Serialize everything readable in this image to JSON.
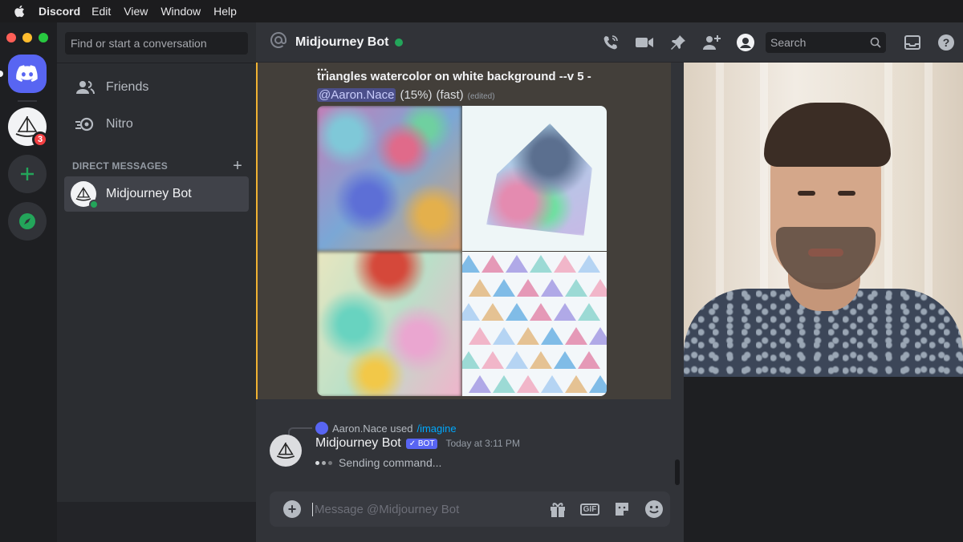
{
  "menubar": {
    "app_name": "Discord",
    "items": [
      "Edit",
      "View",
      "Window",
      "Help"
    ]
  },
  "colors": {
    "blurple": "#5865f2",
    "online": "#23a55a",
    "highlight_border": "#f0b232",
    "mention_badge": "#f23f42"
  },
  "servers": {
    "home_icon": "discord-logo-icon",
    "midjourney_badge": "3",
    "add_icon": "plus-icon",
    "explore_icon": "compass-icon"
  },
  "sidebar": {
    "search_placeholder": "Find or start a conversation",
    "nav": [
      {
        "label": "Friends",
        "icon": "friends-icon"
      },
      {
        "label": "Nitro",
        "icon": "nitro-icon"
      }
    ],
    "dm_header": "DIRECT MESSAGES",
    "dms": [
      {
        "name": "Midjourney Bot",
        "status": "online"
      }
    ]
  },
  "topbar": {
    "channel_name": "Midjourney Bot",
    "search_placeholder": "Search",
    "icons": [
      "call-icon",
      "video-icon",
      "pin-icon",
      "add-friend-icon",
      "profile-icon",
      "inbox-icon",
      "help-icon"
    ]
  },
  "messages": {
    "prompt_line1": "...",
    "prompt_line2": "triangles watercolor on white background --v 5 -",
    "mention": "@Aaron.Nace",
    "progress": "(15%)",
    "speed": "(fast)",
    "edited": "(edited)",
    "used_user": "Aaron.Nace used",
    "used_command": "/imagine",
    "bot_name": "Midjourney Bot",
    "bot_tag": "✓ BOT",
    "timestamp": "Today at 3:11 PM",
    "status": "Sending command..."
  },
  "composer": {
    "placeholder": "Message @Midjourney Bot",
    "icons": [
      "gift-icon",
      "gif-icon",
      "sticker-icon",
      "emoji-icon"
    ],
    "gif_label": "GIF"
  }
}
